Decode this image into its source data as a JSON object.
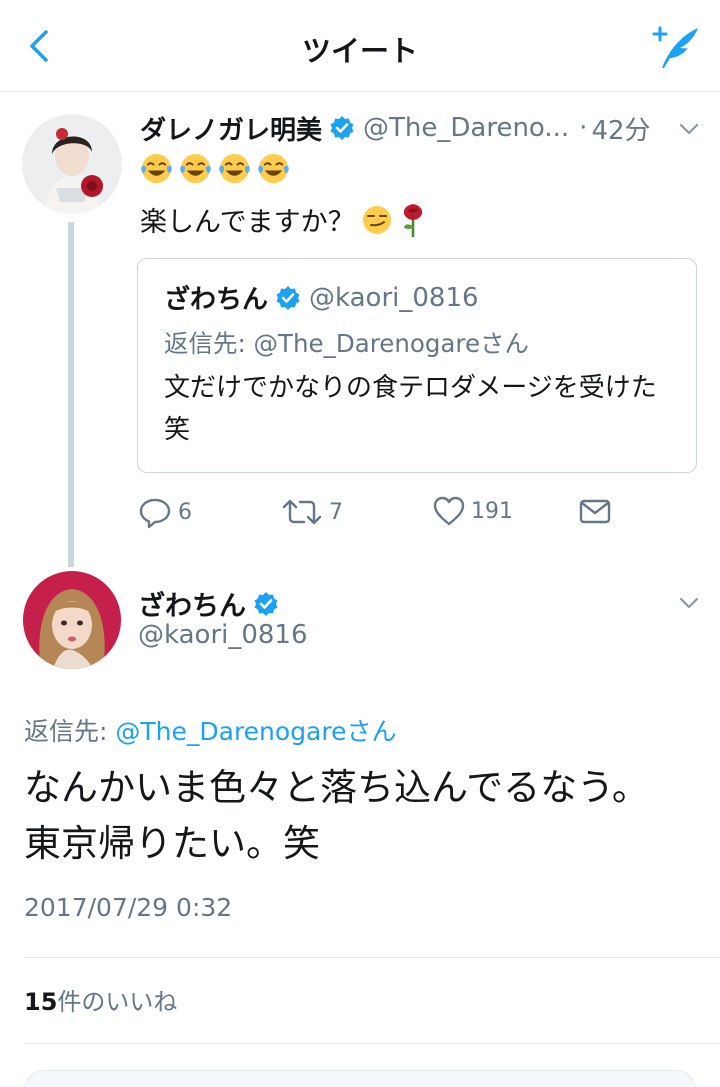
{
  "nav": {
    "title": "ツイート"
  },
  "tweet1": {
    "name": "ダレノガレ明美",
    "handle": "@The_Dareno...",
    "separator": "·",
    "time": "42分",
    "emoji_row": [
      "face-with-tears-of-joy",
      "face-with-tears-of-joy",
      "face-with-tears-of-joy",
      "face-with-tears-of-joy"
    ],
    "text": "楽しんでますか？",
    "text_emojis": [
      "smirking-face",
      "rose"
    ],
    "quote": {
      "name": "ざわちん",
      "handle": "@kaori_0816",
      "reply_to_label": "返信先: @The_Darenogareさん",
      "text": "文だけでかなりの食テロダメージを受けた笑"
    },
    "actions": {
      "replies": "6",
      "retweets": "7",
      "likes": "191"
    }
  },
  "tweet2": {
    "name": "ざわちん",
    "handle": "@kaori_0816",
    "reply_prefix": "返信先: ",
    "reply_handle": "@The_Darenogare",
    "reply_suffix": "さん",
    "text": "なんかいま色々と落ち込んでるなう。東京帰りたい。笑",
    "timestamp": "2017/07/29 0:32",
    "likes_count": "15",
    "likes_label": "件のいいね"
  },
  "colors": {
    "accent": "#1da1f2",
    "secondary_text": "#657786",
    "border": "#e1e8ed"
  }
}
